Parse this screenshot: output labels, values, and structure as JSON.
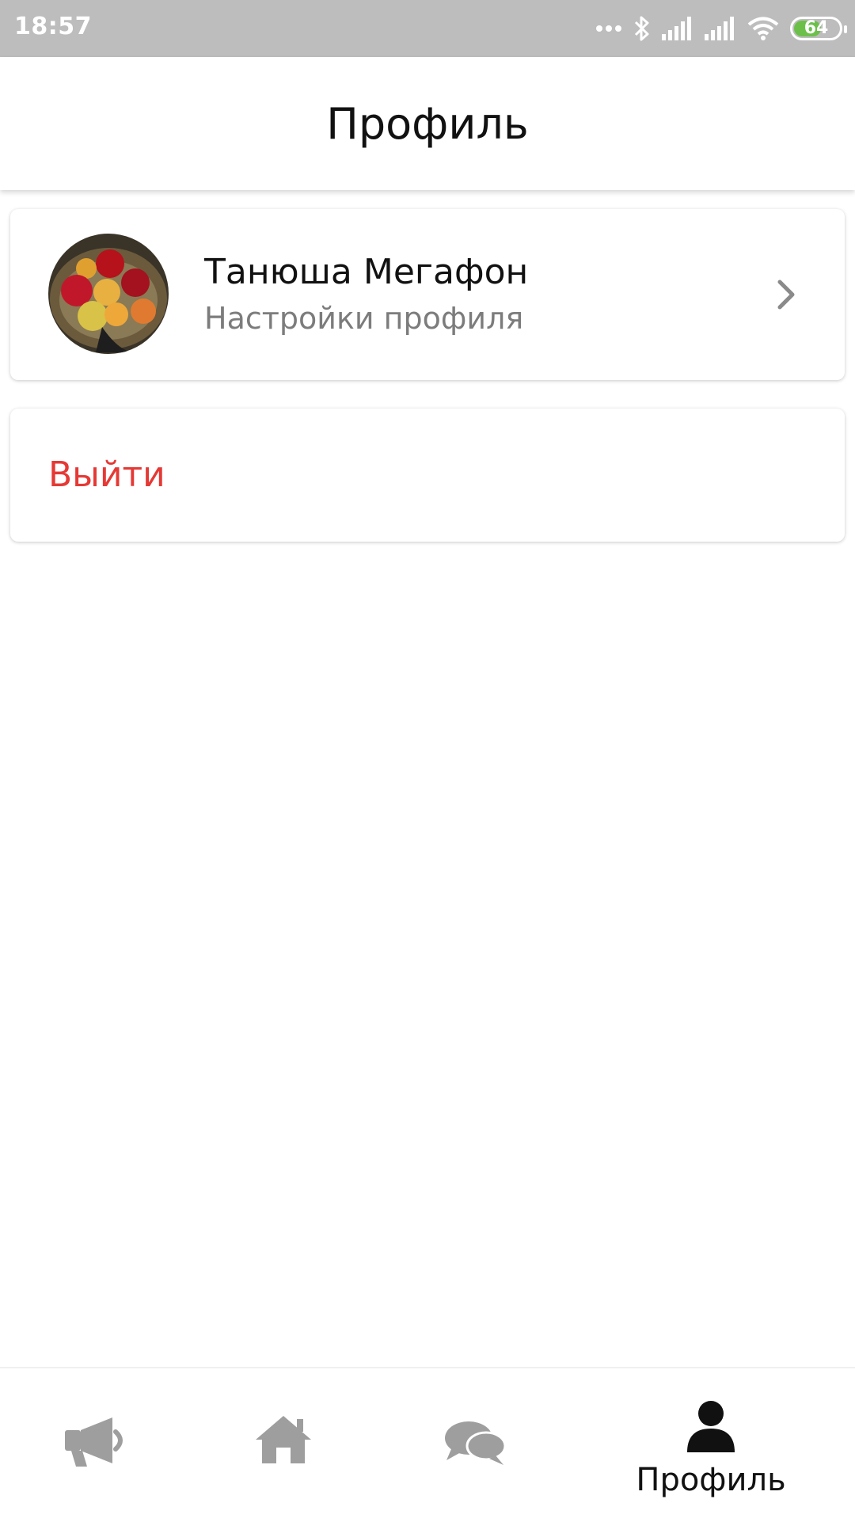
{
  "status_bar": {
    "time": "18:57",
    "battery_level": "64",
    "battery_fraction": 0.64,
    "battery_color": "#6cc04a"
  },
  "header": {
    "title": "Профиль"
  },
  "profile_card": {
    "name": "Танюша Мегафон",
    "subtitle": "Настройки профиля",
    "avatar_icon": "avatar-photo-fruits",
    "chevron_icon": "chevron-right-icon"
  },
  "logout": {
    "label": "Выйти",
    "color": "#e53935"
  },
  "bottom_nav": {
    "items": [
      {
        "icon": "megaphone-icon",
        "label": "",
        "active": false
      },
      {
        "icon": "home-icon",
        "label": "",
        "active": false
      },
      {
        "icon": "chat-icon",
        "label": "",
        "active": false
      },
      {
        "icon": "user-icon",
        "label": "Профиль",
        "active": true
      }
    ],
    "inactive_color": "#9e9e9e",
    "active_color": "#111111"
  }
}
